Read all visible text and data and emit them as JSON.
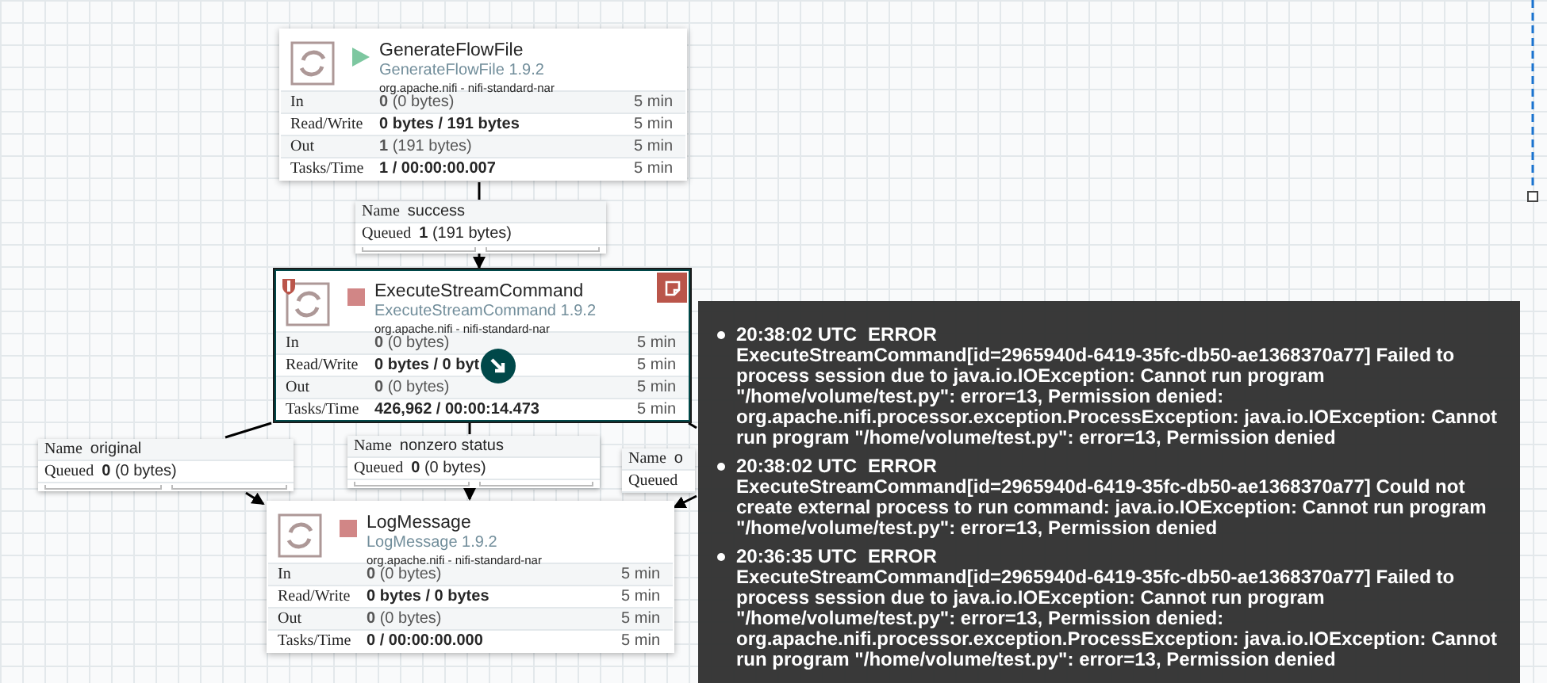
{
  "processors": [
    {
      "name": "GenerateFlowFile",
      "type": "GenerateFlowFile 1.9.2",
      "bundle": "org.apache.nifi - nifi-standard-nar",
      "running": true,
      "selected": false,
      "restricted": false,
      "has_bulletin": false,
      "rows": [
        {
          "label": "In",
          "value": "**0** (0 bytes)",
          "bold": false,
          "time": "5 min"
        },
        {
          "label": "Read/Write",
          "value": "0 bytes / 191 bytes",
          "bold": true,
          "time": "5 min"
        },
        {
          "label": "Out",
          "value": "**1** (191 bytes)",
          "bold": false,
          "time": "5 min"
        },
        {
          "label": "Tasks/Time",
          "value": "1 / 00:00:00.007",
          "bold": true,
          "time": "5 min"
        }
      ]
    },
    {
      "name": "ExecuteStreamCommand",
      "type": "ExecuteStreamCommand 1.9.2",
      "bundle": "org.apache.nifi - nifi-standard-nar",
      "running": false,
      "selected": true,
      "restricted": true,
      "has_bulletin": true,
      "rows": [
        {
          "label": "In",
          "value": "**0** (0 bytes)",
          "bold": false,
          "time": "5 min"
        },
        {
          "label": "Read/Write",
          "value": "0 bytes / 0 byt",
          "bold": true,
          "time": "5 min",
          "cursor": true
        },
        {
          "label": "Out",
          "value": "**0** (0 bytes)",
          "bold": false,
          "time": "5 min"
        },
        {
          "label": "Tasks/Time",
          "value": "426,962 / 00:00:14.473",
          "bold": true,
          "time": "5 min"
        }
      ]
    },
    {
      "name": "LogMessage",
      "type": "LogMessage 1.9.2",
      "bundle": "org.apache.nifi - nifi-standard-nar",
      "running": false,
      "selected": false,
      "restricted": false,
      "has_bulletin": false,
      "rows": [
        {
          "label": "In",
          "value": "**0** (0 bytes)",
          "bold": false,
          "time": "5 min"
        },
        {
          "label": "Read/Write",
          "value": "0 bytes / 0 bytes",
          "bold": true,
          "time": "5 min"
        },
        {
          "label": "Out",
          "value": "**0** (0 bytes)",
          "bold": false,
          "time": "5 min"
        },
        {
          "label": "Tasks/Time",
          "value": "0 / 00:00:00.000",
          "bold": true,
          "time": "5 min"
        }
      ]
    }
  ],
  "connections": [
    {
      "name_label": "Name",
      "name": "success",
      "queued_label": "Queued",
      "queued": "**1** (191 bytes)"
    },
    {
      "name_label": "Name",
      "name": "original",
      "queued_label": "Queued",
      "queued": "**0** (0 bytes)"
    },
    {
      "name_label": "Name",
      "name": "nonzero status",
      "queued_label": "Queued",
      "queued": "**0** (0 bytes)"
    },
    {
      "name_label": "Name",
      "name": "o",
      "queued_label": "Queued"
    }
  ],
  "bulletins": [
    {
      "time": "20:38:02 UTC",
      "level": "ERROR",
      "message": "ExecuteStreamCommand[id=2965940d-6419-35fc-db50-ae1368370a77] Failed to process session due to java.io.IOException: Cannot run program \"/home/volume/test.py\": error=13, Permission denied: org.apache.nifi.processor.exception.ProcessException: java.io.IOException: Cannot run program \"/home/volume/test.py\": error=13, Permission denied"
    },
    {
      "time": "20:38:02 UTC",
      "level": "ERROR",
      "message": "ExecuteStreamCommand[id=2965940d-6419-35fc-db50-ae1368370a77] Could not create external process to run command: java.io.IOException: Cannot run program \"/home/volume/test.py\": error=13, Permission denied"
    },
    {
      "time": "20:36:35 UTC",
      "level": "ERROR",
      "message": "ExecuteStreamCommand[id=2965940d-6419-35fc-db50-ae1368370a77] Failed to process session due to java.io.IOException: Cannot run program \"/home/volume/test.py\": error=13, Permission denied: org.apache.nifi.processor.exception.ProcessException: java.io.IOException: Cannot run program \"/home/volume/test.py\": error=13, Permission denied"
    }
  ]
}
